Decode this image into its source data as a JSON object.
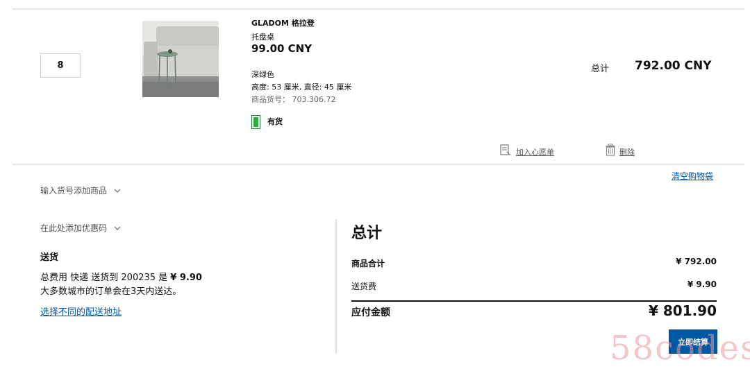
{
  "cart_item": {
    "quantity": "8",
    "name": "GLADOM 格拉登",
    "type": "托盘桌",
    "unit_price": "99.00 CNY",
    "color": "深绿色",
    "dimensions": "高度: 53 厘米, 直径: 45 厘米",
    "article_number": "商品货号：  703.306.72",
    "stock_status": "有货",
    "stock_color": "#1fb43a",
    "line_total_label": "总计",
    "line_total": "792.00 CNY",
    "wishlist_label": "加入心愿单",
    "delete_label": "删除"
  },
  "clear_bag_label": "清空购物袋",
  "enter_article_label": "输入货号添加商品",
  "promo_label": "在此处添加优惠码",
  "delivery": {
    "title": "送货",
    "cost_prefix": "总费用 快递 送货到 200235 是",
    "cost_value": "¥ 9.90",
    "note": "大多数城市的订单会在3天内送达。",
    "change_address_label": "选择不同的配送地址"
  },
  "summary": {
    "title": "总计",
    "subtotal_label": "商品合计",
    "subtotal_value": "¥ 792.00",
    "shipping_label": "送货费",
    "shipping_value": "¥ 9.90",
    "grand_total_label": "应付金额",
    "grand_total_value": "¥ 801.90",
    "checkout_label": "立即结算",
    "accent_color": "#0058a3"
  },
  "watermark_text": "58codes"
}
